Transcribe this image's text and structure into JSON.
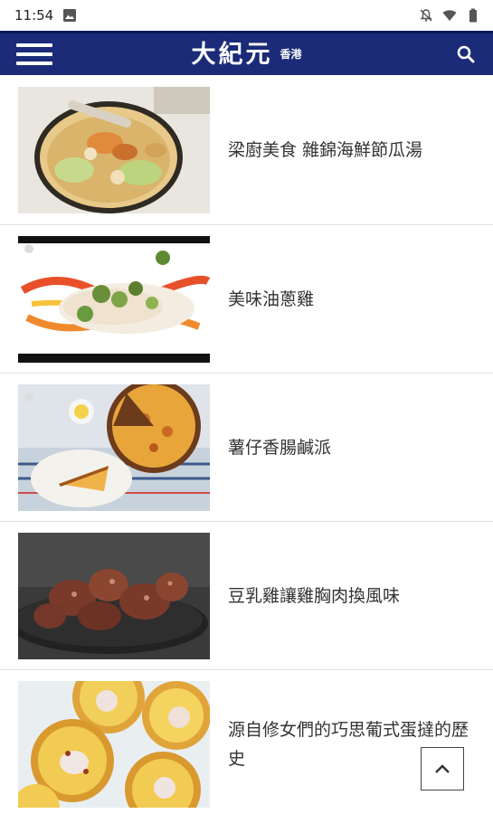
{
  "status_bar": {
    "time": "11:54",
    "left_icon": "image-icon",
    "right_icons": [
      "notifications-off-icon",
      "wifi-icon",
      "battery-icon"
    ]
  },
  "header": {
    "brand_main": "大紀元",
    "brand_region": "香港",
    "menu_icon": "hamburger-menu-icon",
    "search_icon": "search-icon",
    "background_color": "#1b2b78"
  },
  "articles": [
    {
      "title": "梁廚美食 雜錦海鮮節瓜湯",
      "thumbnail": "seafood-melon-soup"
    },
    {
      "title": "美味油蔥雞",
      "thumbnail": "scallion-oil-chicken"
    },
    {
      "title": "薯仔香腸鹹派",
      "thumbnail": "potato-sausage-quiche"
    },
    {
      "title": "豆乳雞讓雞胸肉換風味",
      "thumbnail": "fried-chicken-pieces"
    },
    {
      "title": "源自修女們的巧思葡式蛋撻的歷史",
      "thumbnail": "portuguese-egg-tarts"
    }
  ],
  "back_to_top_icon": "chevron-up-icon"
}
